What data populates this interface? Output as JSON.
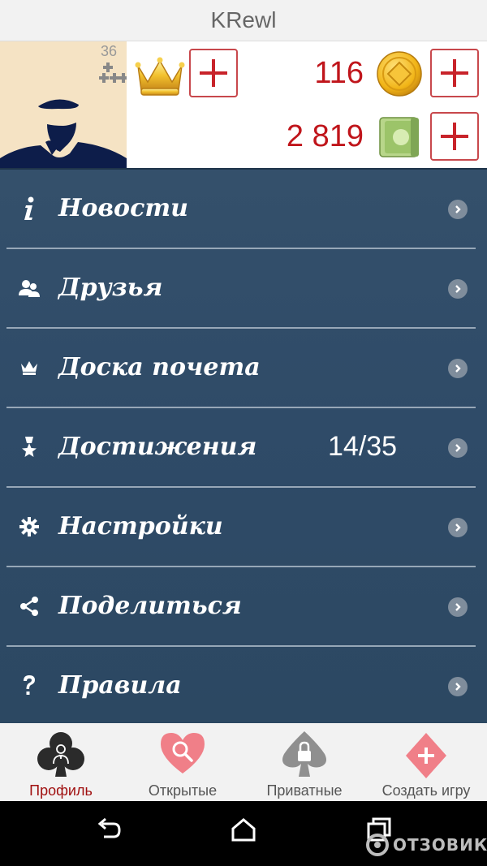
{
  "header": {
    "title": "KRewl"
  },
  "profile": {
    "level": "36",
    "plus_glyph": "✚✚✚✚",
    "coins": "116",
    "cash": "2 819"
  },
  "menu": {
    "items": [
      {
        "icon": "info-icon",
        "label": "Новости"
      },
      {
        "icon": "friends-icon",
        "label": "Друзья"
      },
      {
        "icon": "crown-icon",
        "label": "Доска почета"
      },
      {
        "icon": "medal-icon",
        "label": "Достижения",
        "count": "14/35"
      },
      {
        "icon": "gear-icon",
        "label": "Настройки"
      },
      {
        "icon": "share-icon",
        "label": "Поделиться"
      },
      {
        "icon": "question-icon",
        "label": "Правила"
      }
    ]
  },
  "tabs": [
    {
      "label": "Профиль",
      "active": true,
      "icon": "club-person-icon"
    },
    {
      "label": "Открытые",
      "active": false,
      "icon": "heart-search-icon"
    },
    {
      "label": "Приватные",
      "active": false,
      "icon": "spade-lock-icon"
    },
    {
      "label": "Создать игру",
      "active": false,
      "icon": "diamond-plus-icon"
    }
  ],
  "watermark": {
    "text": "ОТЗОВИК"
  },
  "colors": {
    "accent": "#c0151b",
    "menu_bg": "#2f4b68",
    "active_tab": "#a01010"
  }
}
